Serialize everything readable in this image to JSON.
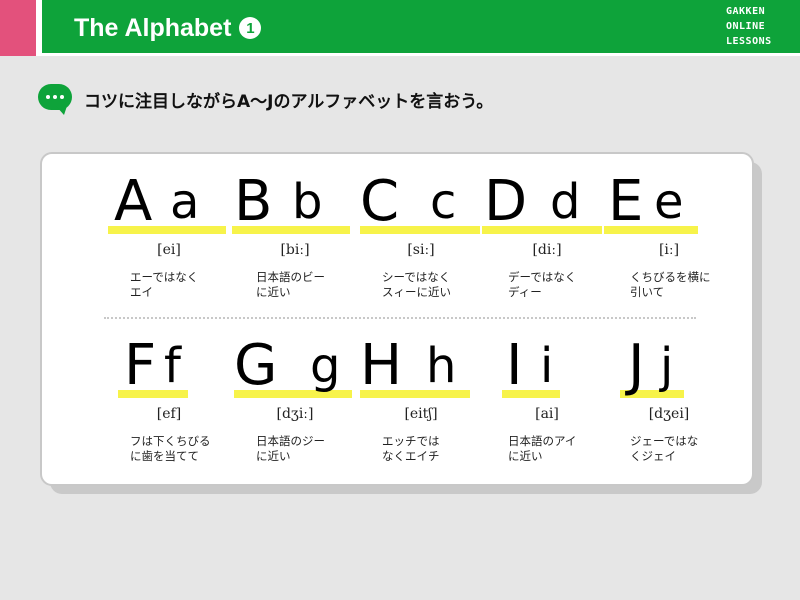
{
  "header": {
    "title": "The Alphabet",
    "number": "1",
    "brand_lines": [
      "GAKKEN",
      "ONLINE",
      "LESSONS"
    ]
  },
  "instruction": {
    "text": "コツに注目しながらA〜Jのアルファベットを言おう。"
  },
  "rows": [
    [
      {
        "upper": "A",
        "lower": "a",
        "ipa": "[ei]",
        "desc": "エーではなく\nエイ"
      },
      {
        "upper": "B",
        "lower": "b",
        "ipa": "[biː]",
        "desc": "日本語のビー\nに近い"
      },
      {
        "upper": "C",
        "lower": "c",
        "ipa": "[siː]",
        "desc": "シーではなく\nスィーに近い"
      },
      {
        "upper": "D",
        "lower": "d",
        "ipa": "[diː]",
        "desc": "デーではなく\nディー"
      },
      {
        "upper": "E",
        "lower": "e",
        "ipa": "[iː]",
        "desc": "くちびるを横に\n引いて"
      }
    ],
    [
      {
        "upper": "F",
        "lower": "f",
        "ipa": "[ef]",
        "desc": "フは下くちびる\nに歯を当てて"
      },
      {
        "upper": "G",
        "lower": "g",
        "ipa": "[dʒiː]",
        "desc": "日本語のジー\nに近い"
      },
      {
        "upper": "H",
        "lower": "h",
        "ipa": "[eitʃ]",
        "desc": "エッチでは\nなくエイチ"
      },
      {
        "upper": "I",
        "lower": "i",
        "ipa": "[ai]",
        "desc": "日本語のアイ\nに近い"
      },
      {
        "upper": "J",
        "lower": "j",
        "ipa": "[dʒei]",
        "desc": "ジェーではな\nくジェイ"
      }
    ]
  ],
  "colors": {
    "header_green": "#0ea33a",
    "header_pink": "#e3517c",
    "highlight_yellow": "#f7f34a"
  },
  "icons": {
    "instruction": "speech-bubble-icon"
  }
}
